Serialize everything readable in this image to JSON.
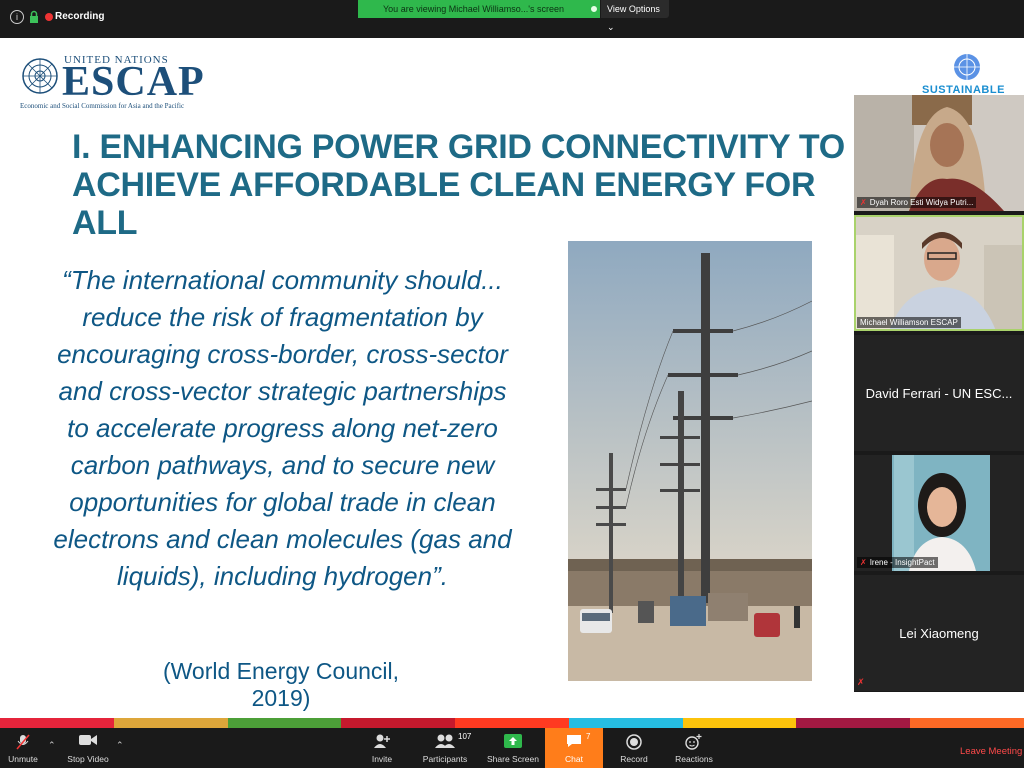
{
  "topbar": {
    "recording_label": "Recording",
    "share_banner": "You are viewing Michael Williamso...'s screen",
    "view_options": "View Options"
  },
  "slide": {
    "logo": {
      "un_text": "UNITED NATIONS",
      "escap": "ESCAP",
      "subtitle": "Economic and Social Commission for Asia and the Pacific"
    },
    "sdg_text": "SUSTAINABLE",
    "title_line1": "I. ENHANCING POWER GRID CONNECTIVITY TO",
    "title_line2": "ACHIEVE AFFORDABLE CLEAN ENERGY FOR ALL",
    "quote_lines": [
      "“The international community should...",
      "reduce the risk of fragmentation by",
      "encouraging cross-border, cross-sector",
      "and cross-vector strategic partnerships",
      "to accelerate progress along net-zero",
      "carbon pathways, and to secure new",
      "opportunities for global trade in clean",
      "electrons and clean molecules (gas and",
      "liquids), including hydrogen”."
    ],
    "citation": "(World Energy Council, 2019)",
    "strip_colors": [
      "#e5243b",
      "#dda63a",
      "#4c9f38",
      "#c5192d",
      "#ff3a21",
      "#26bde2",
      "#fcc30b",
      "#a21942",
      "#fd6925"
    ]
  },
  "participants": [
    {
      "name": "Dyah Roro Esti Widya Putri...",
      "muted": true,
      "video": true
    },
    {
      "name": "Michael Williamson ESCAP",
      "muted": false,
      "video": true,
      "active": true
    },
    {
      "name": "David Ferrari - UN ESC...",
      "muted": false,
      "video": false
    },
    {
      "name": "Irene - InsightPact",
      "muted": true,
      "video": true
    },
    {
      "name": "Lei Xiaomeng",
      "muted": true,
      "video": false
    }
  ],
  "toolbar": {
    "unmute": "Unmute",
    "stop_video": "Stop Video",
    "invite": "Invite",
    "participants": "Participants",
    "participants_count": "107",
    "share_screen": "Share Screen",
    "chat": "Chat",
    "chat_count": "7",
    "record": "Record",
    "reactions": "Reactions",
    "leave": "Leave Meeting"
  },
  "colors": {
    "title": "#1e6a86",
    "quote": "#0e5785",
    "share_green": "#2fb84c",
    "chat_orange": "#ff7d1a",
    "leave_red": "#ff4a4a"
  }
}
